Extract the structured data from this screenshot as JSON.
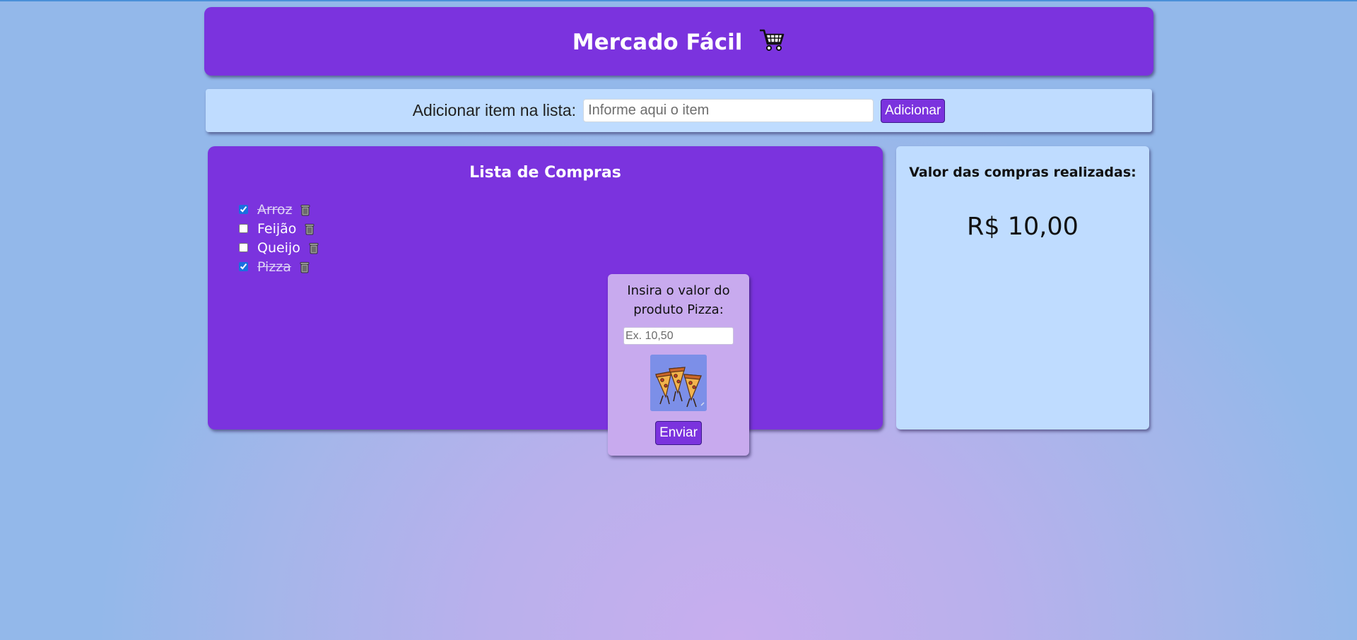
{
  "header": {
    "title": "Mercado Fácil",
    "icon": "shopping-cart-icon"
  },
  "add_item": {
    "label": "Adicionar item na lista:",
    "placeholder": "Informe aqui o item",
    "value": "",
    "button_label": "Adicionar"
  },
  "list": {
    "title": "Lista de Compras",
    "items": [
      {
        "name": "Arroz",
        "checked": true
      },
      {
        "name": "Feijão",
        "checked": false
      },
      {
        "name": "Queijo",
        "checked": false
      },
      {
        "name": "Pizza",
        "checked": true
      }
    ],
    "delete_icon": "trash-icon"
  },
  "total": {
    "title": "Valor das compras realizadas:",
    "value": "R$ 10,00"
  },
  "price_popup": {
    "prompt": "Insira o valor do produto Pizza:",
    "placeholder": "Ex. 10,50",
    "value": "",
    "image_icon": "pizza-slices-image",
    "button_label": "Enviar"
  },
  "colors": {
    "primary_purple": "#7b33de",
    "light_blue_panel": "#bfdcff",
    "popup_lilac": "#c8aaee"
  }
}
